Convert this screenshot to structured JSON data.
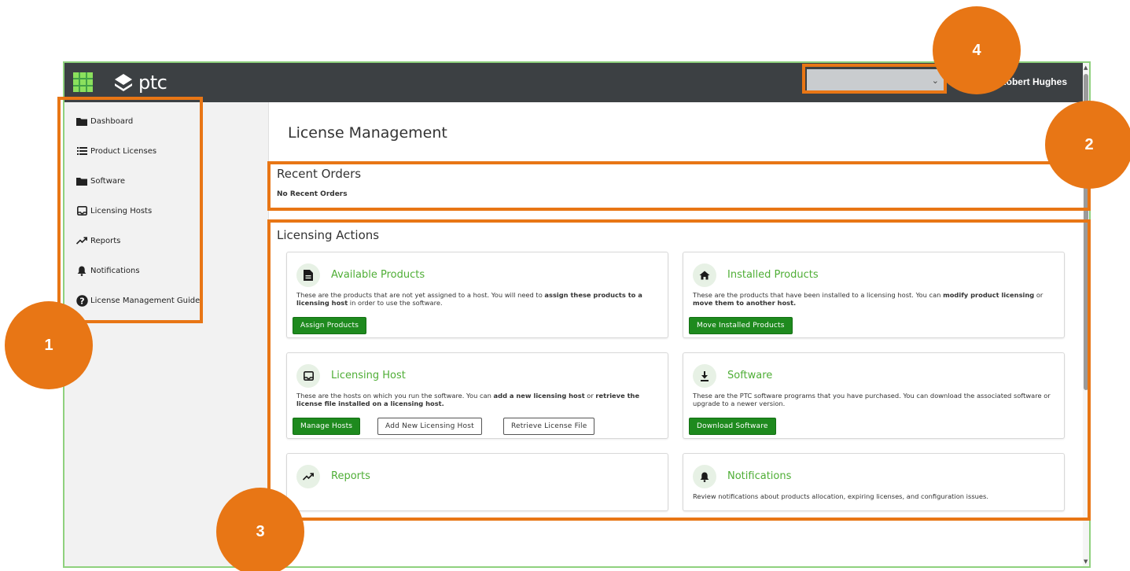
{
  "app": {
    "brand": "ptc",
    "user": "Robert Hughes"
  },
  "sidebar": {
    "items": [
      {
        "label": "Dashboard",
        "icon": "folder-icon"
      },
      {
        "label": "Product Licenses",
        "icon": "list-icon"
      },
      {
        "label": "Software",
        "icon": "folder-icon"
      },
      {
        "label": "Licensing Hosts",
        "icon": "inbox-icon"
      },
      {
        "label": "Reports",
        "icon": "trend-icon"
      },
      {
        "label": "Notifications",
        "icon": "bell-icon"
      },
      {
        "label": "License Management Guide",
        "icon": "help-icon"
      }
    ]
  },
  "main": {
    "title": "License Management",
    "recent_orders": {
      "title": "Recent Orders",
      "empty_text": "No Recent Orders"
    },
    "licensing_actions": {
      "title": "Licensing Actions",
      "cards": {
        "available": {
          "title": "Available Products",
          "icon": "document-icon",
          "desc_parts": [
            "These are the products that are not yet assigned to a host. You will need to ",
            "assign these products to a licensing host",
            " in order to use the software."
          ],
          "buttons": [
            "Assign Products"
          ]
        },
        "installed": {
          "title": "Installed Products",
          "icon": "home-icon",
          "desc_parts": [
            "These are the products that have been installed to a licensing host. You can ",
            "modify product licensing",
            " or ",
            "move them to another host."
          ],
          "buttons": [
            "Move Installed Products"
          ]
        },
        "host": {
          "title": "Licensing Host",
          "icon": "inbox-icon",
          "desc_parts": [
            "These are the hosts on which you run the software. You can ",
            "add a new licensing host",
            " or ",
            "retrieve the license file installed on a licensing host."
          ],
          "buttons": [
            "Manage Hosts",
            "Add New Licensing Host",
            "Retrieve License File"
          ]
        },
        "software": {
          "title": "Software",
          "icon": "download-icon",
          "desc": "These are the PTC software programs that you have purchased. You can download the associated software or upgrade to a newer version.",
          "buttons": [
            "Download Software"
          ]
        },
        "reports": {
          "title": "Reports",
          "icon": "trend-icon"
        },
        "notifications": {
          "title": "Notifications",
          "icon": "bell-icon",
          "desc": "Review notifications about products allocation, expiring licenses, and configuration issues."
        }
      }
    }
  },
  "annotations": {
    "badges": [
      "1",
      "2",
      "3",
      "4"
    ],
    "color": "#e87615"
  },
  "colors": {
    "topbar": "#3c4043",
    "accent_green": "#4fae36",
    "button_green": "#1e8a1e"
  }
}
